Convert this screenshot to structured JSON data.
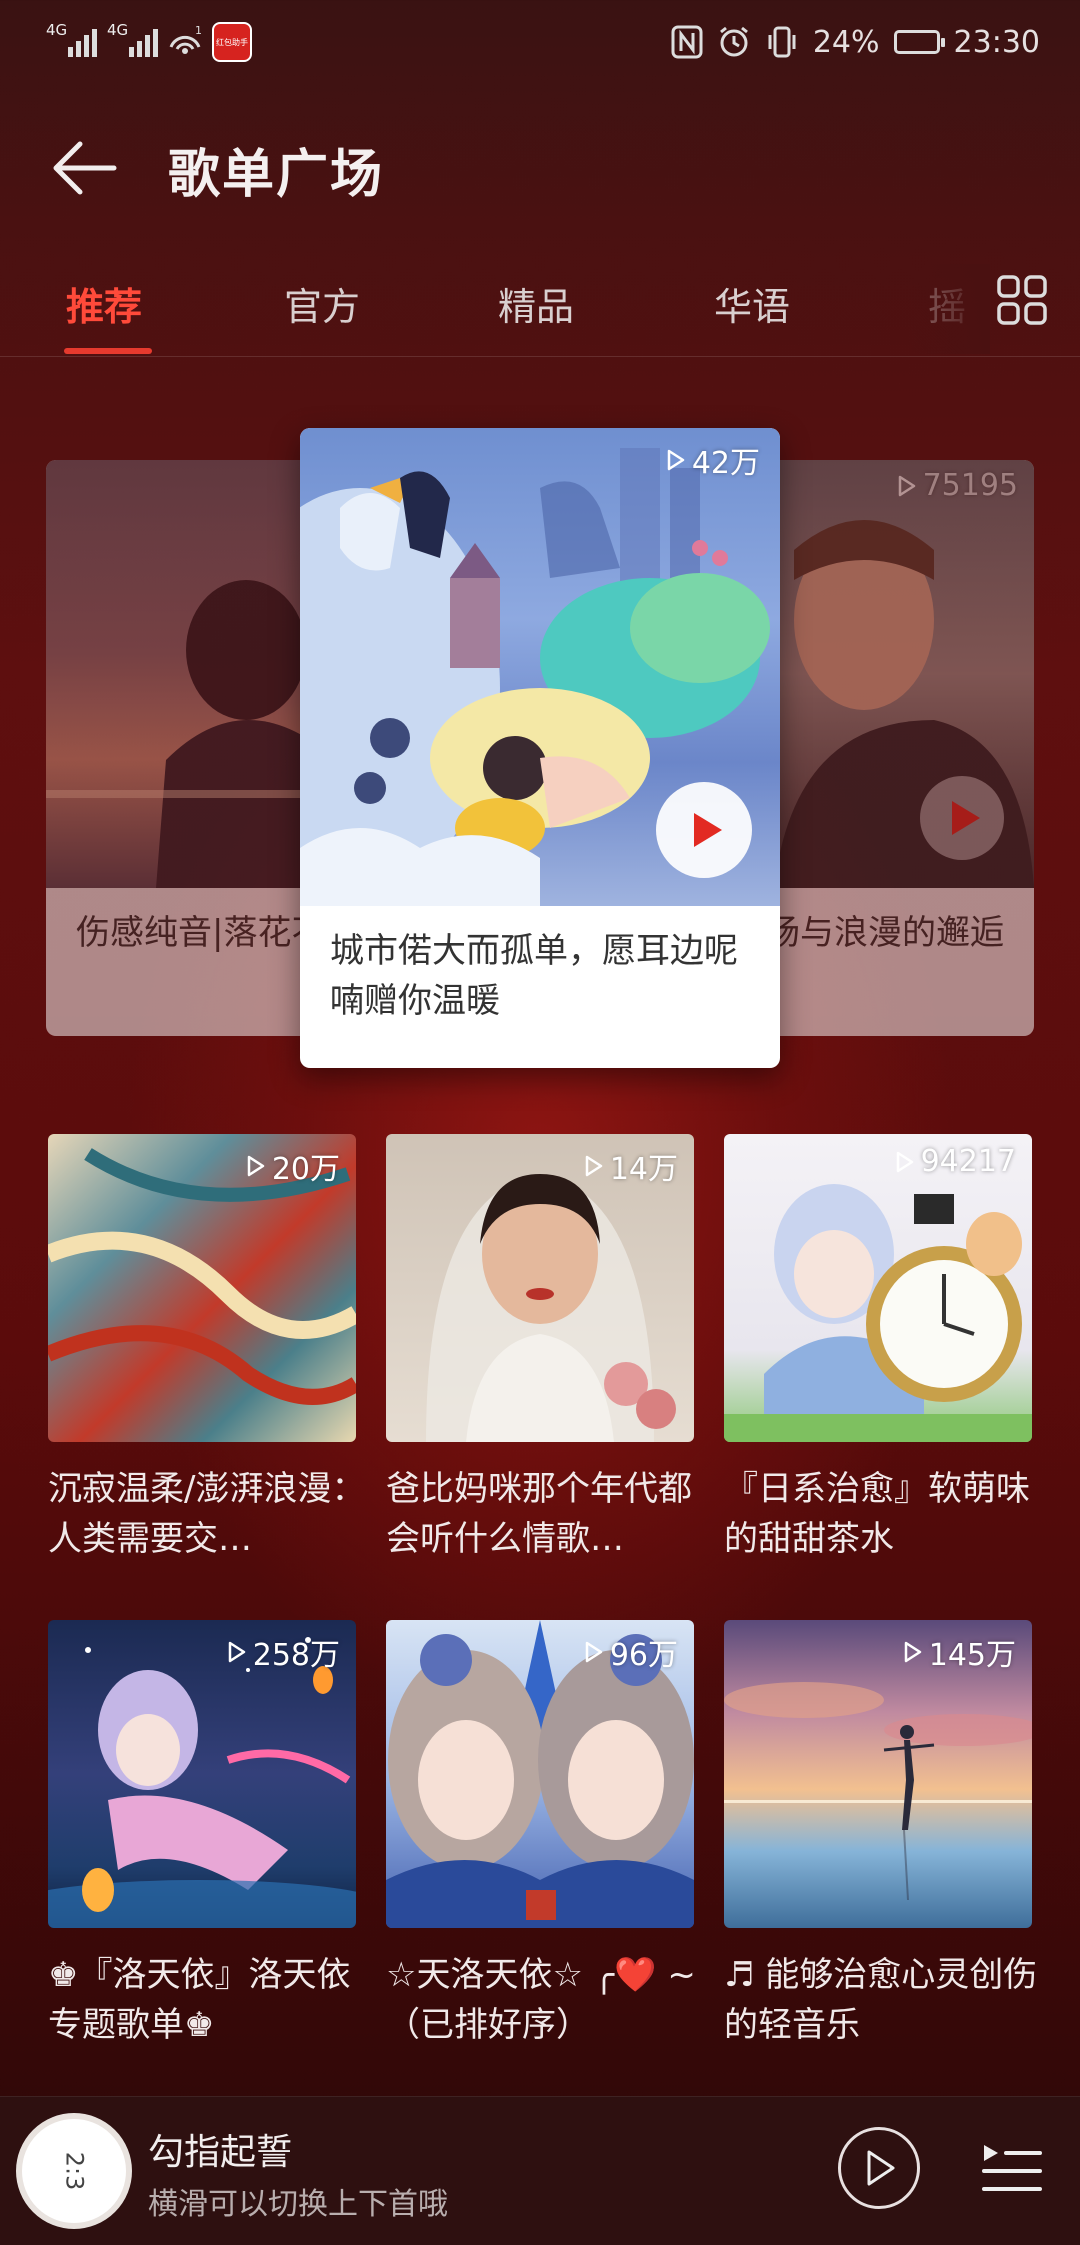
{
  "status_bar": {
    "signal1_label": "4G",
    "signal2_label": "4G",
    "wifi_badge": "1",
    "app_badge_label": "红包助手",
    "battery_text": "24%",
    "time": "23:30"
  },
  "header": {
    "title": "歌单广场"
  },
  "tabs": [
    {
      "label": "推荐",
      "active": true
    },
    {
      "label": "官方",
      "active": false
    },
    {
      "label": "精品",
      "active": false
    },
    {
      "label": "华语",
      "active": false
    },
    {
      "label": "摇",
      "active": false
    }
  ],
  "carousel": {
    "left": {
      "count": "",
      "caption": "伤感纯音|落花不是无情物 化作春泥更护花头"
    },
    "center": {
      "count": "42万",
      "caption": "城市偌大而孤单，愿耳边呢喃赠你温暖"
    },
    "right": {
      "count": "75195",
      "caption": "浪漫 来一场与浪漫的邂逅"
    }
  },
  "playlists": [
    {
      "count": "20万",
      "title": "沉寂温柔/澎湃浪漫：人类需要交…"
    },
    {
      "count": "14万",
      "title": "爸比妈咪那个年代都会听什么情歌…"
    },
    {
      "count": "94217",
      "title": "『日系治愈』软萌味的甜甜茶水"
    },
    {
      "count": "258万",
      "title": "♚『洛天依』洛天依专题歌单♚"
    },
    {
      "count": "96万",
      "title": "☆天洛天依☆ ╭❤️ ~（已排好序）"
    },
    {
      "count": "145万",
      "title": "♬ 能够治愈心灵创伤的轻音乐"
    }
  ],
  "player": {
    "disc_label": "2:3",
    "song": "勾指起誓",
    "hint": "横滑可以切换上下首哦"
  },
  "colors": {
    "accent": "#e63a2e",
    "background": "#5b0b0b",
    "player_bar": "#2e1010"
  },
  "icons": [
    "back-arrow-icon",
    "grid-icon",
    "play-count-icon",
    "play-icon",
    "playlist-icon",
    "wifi-icon",
    "nfc-icon",
    "alarm-icon",
    "vibrate-icon",
    "battery-icon"
  ]
}
